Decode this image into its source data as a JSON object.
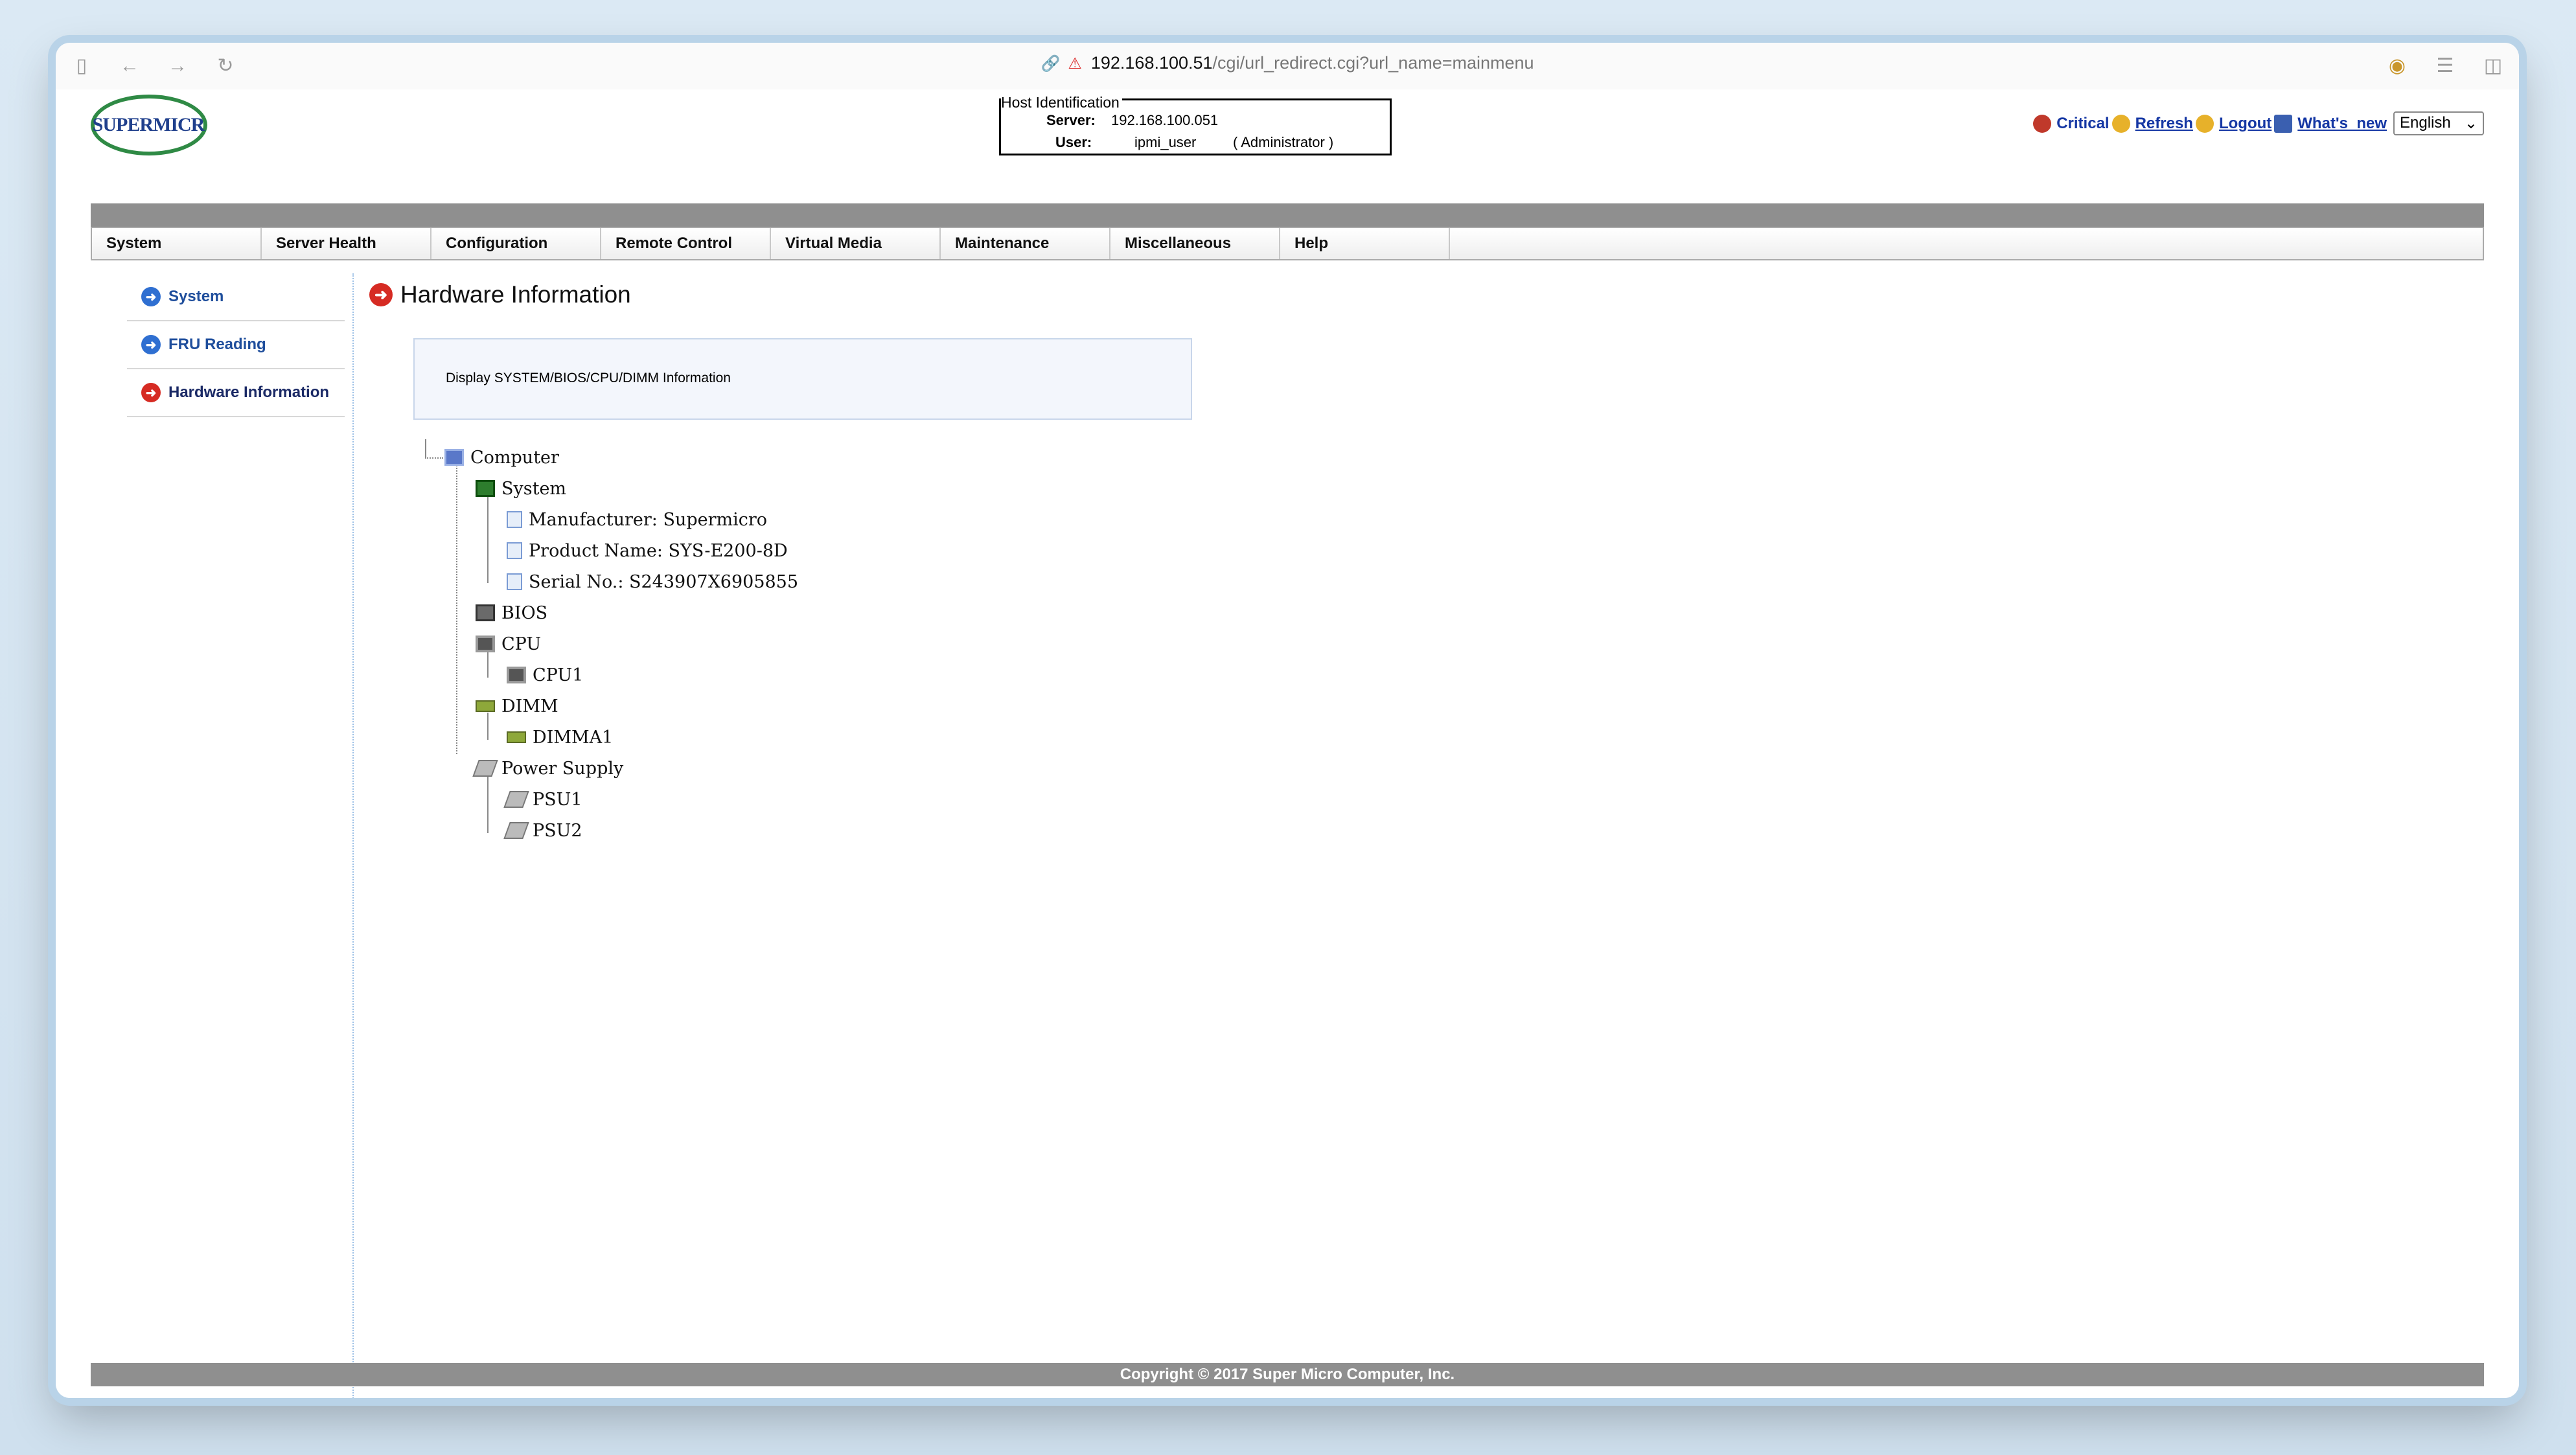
{
  "browser": {
    "url_host": "192.168.100.51",
    "url_path": "/cgi/url_redirect.cgi?url_name=mainmenu"
  },
  "header": {
    "logo_text": "SUPERMICR",
    "host_box": {
      "legend": "Host Identification",
      "server_label": "Server:",
      "server_value": "192.168.100.051",
      "user_label": "User:",
      "user_value": "ipmi_user",
      "user_role": "( Administrator )"
    },
    "links": {
      "critical": "Critical",
      "refresh": "Refresh",
      "logout": "Logout",
      "whats_new": "What's_new"
    },
    "language": "English"
  },
  "menu": [
    "System",
    "Server Health",
    "Configuration",
    "Remote Control",
    "Virtual Media",
    "Maintenance",
    "Miscellaneous",
    "Help"
  ],
  "sidebar": {
    "items": [
      {
        "label": "System"
      },
      {
        "label": "FRU Reading"
      },
      {
        "label": "Hardware Information"
      }
    ]
  },
  "main": {
    "title": "Hardware Information",
    "description": "Display SYSTEM/BIOS/CPU/DIMM Information",
    "tree": {
      "computer": "Computer",
      "system": "System",
      "manufacturer": "Manufacturer: Supermicro",
      "product": "Product Name: SYS-E200-8D",
      "serial": "Serial No.: S243907X6905855",
      "bios": "BIOS",
      "cpu": "CPU",
      "cpu1": "CPU1",
      "dimm": "DIMM",
      "dimma1": "DIMMA1",
      "power": "Power Supply",
      "psu1": "PSU1",
      "psu2": "PSU2"
    }
  },
  "footer": {
    "copyright": "Copyright © 2017 Super Micro Computer, Inc."
  }
}
